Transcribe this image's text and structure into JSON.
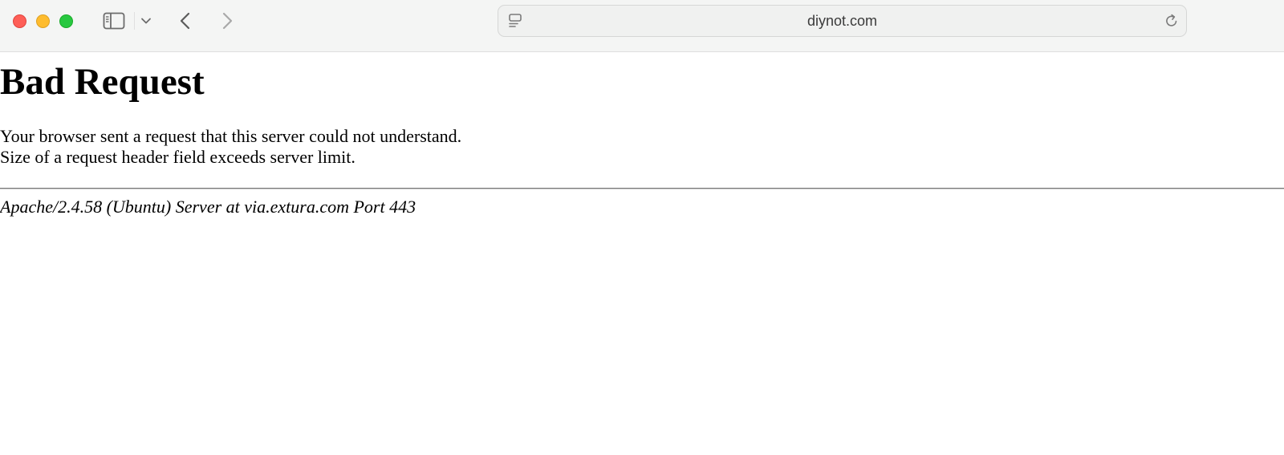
{
  "browser": {
    "url": "diynot.com",
    "traffic_light_colors": {
      "close": "#fe5f57",
      "minimize": "#febc2e",
      "maximize": "#28c840"
    },
    "icons": [
      "sidebar-icon",
      "chevron-down-icon",
      "back-icon",
      "forward-icon",
      "page-menu-icon",
      "reload-icon"
    ]
  },
  "page": {
    "title": "Bad Request",
    "message_lines": [
      "Your browser sent a request that this server could not understand.",
      "Size of a request header field exceeds server limit."
    ],
    "server_signature": "Apache/2.4.58 (Ubuntu) Server at via.extura.com Port 443"
  }
}
